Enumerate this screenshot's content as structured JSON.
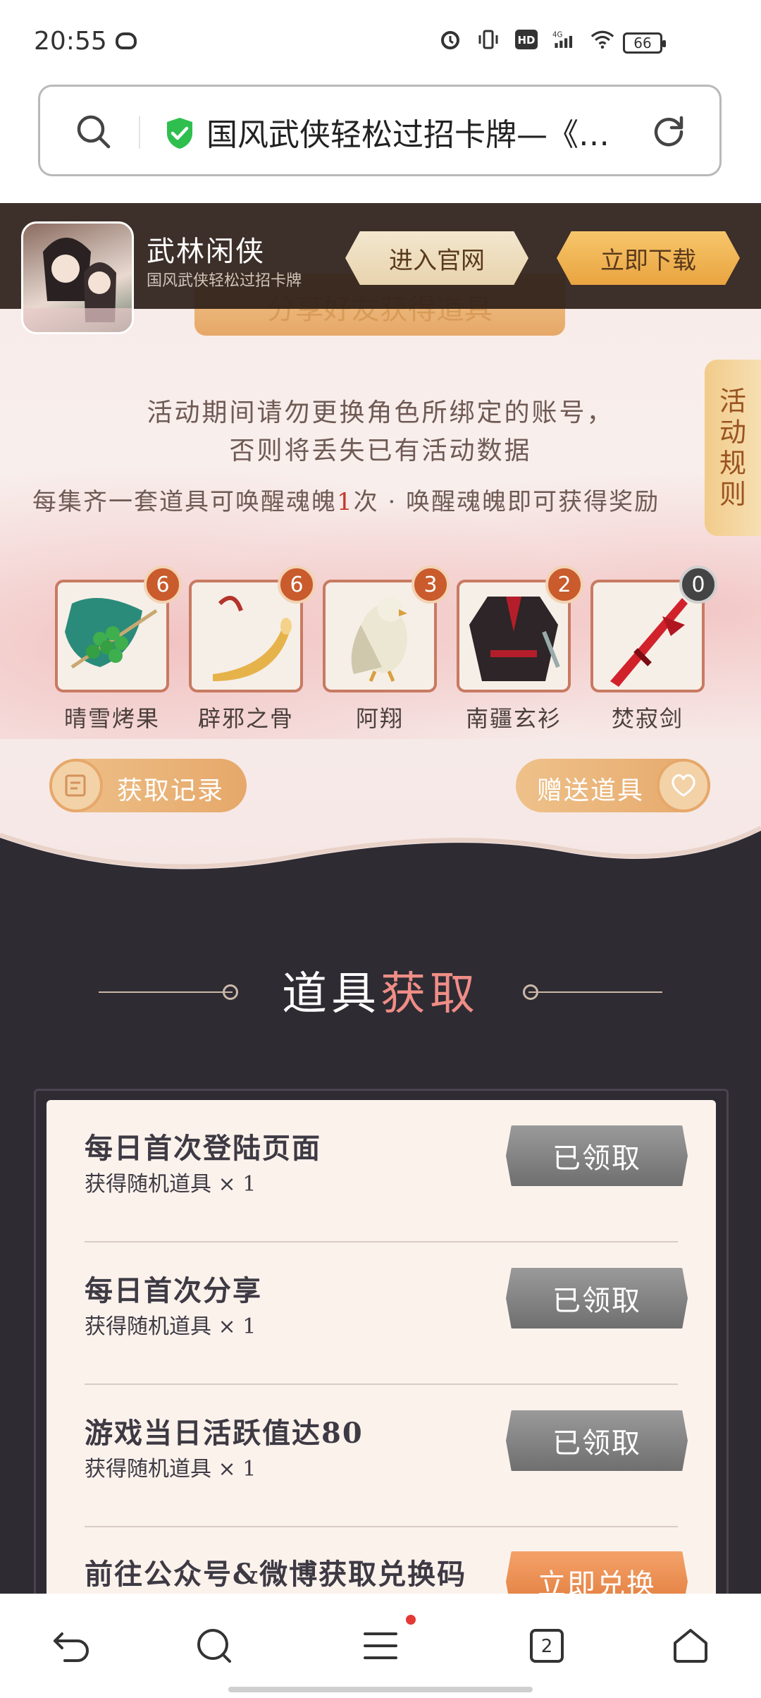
{
  "status": {
    "time": "20:55",
    "battery": "66",
    "network": "4G",
    "hd": "HD"
  },
  "browser": {
    "title": "国风武侠轻松过招卡牌—《…"
  },
  "banner": {
    "app_name": "武林闲侠",
    "app_subtitle": "国风武侠轻松过招卡牌",
    "official_site_label": "进入官网",
    "download_label": "立即下载"
  },
  "share": {
    "label": "分享好友获得道具"
  },
  "rules_tab": [
    "活",
    "动",
    "规",
    "则"
  ],
  "notices": {
    "line1": "活动期间请勿更换角色所绑定的账号，",
    "line2": "否则将丢失已有活动数据",
    "line3_a": "每集齐一套道具可唤醒魂魄",
    "line3_num": "1",
    "line3_b": "次 · 唤醒魂魄即可获得奖励"
  },
  "items": [
    {
      "name": "晴雪烤果",
      "count": "6",
      "icon": "berry-branch-icon",
      "color": "#2d8a5f"
    },
    {
      "name": "辟邪之骨",
      "count": "6",
      "icon": "bone-horn-icon",
      "color": "#d8a040"
    },
    {
      "name": "阿翔",
      "count": "3",
      "icon": "eagle-icon",
      "color": "#c9c2a2"
    },
    {
      "name": "南疆玄衫",
      "count": "2",
      "icon": "robe-icon",
      "color": "#3b2b2e"
    },
    {
      "name": "焚寂剑",
      "count": "0",
      "icon": "red-sword-icon",
      "color": "#c8242c"
    }
  ],
  "actions": {
    "record_label": "获取记录",
    "gift_label": "赠送道具"
  },
  "section": {
    "title_a": "道具",
    "title_b": "获取"
  },
  "tasks": [
    {
      "title": "每日首次登陆页面",
      "reward": "获得随机道具 × 1",
      "button": "已领取",
      "state": "claimed"
    },
    {
      "title": "每日首次分享",
      "reward": "获得随机道具 × 1",
      "button": "已领取",
      "state": "claimed"
    },
    {
      "title": "游戏当日活跃值达80",
      "reward": "获得随机道具 × 1",
      "button": "已领取",
      "state": "claimed"
    },
    {
      "title": "前往公众号&微博获取兑换码",
      "reward": "",
      "button": "立即兑换",
      "state": "active"
    }
  ],
  "nav": {
    "tabs_count": "2"
  }
}
